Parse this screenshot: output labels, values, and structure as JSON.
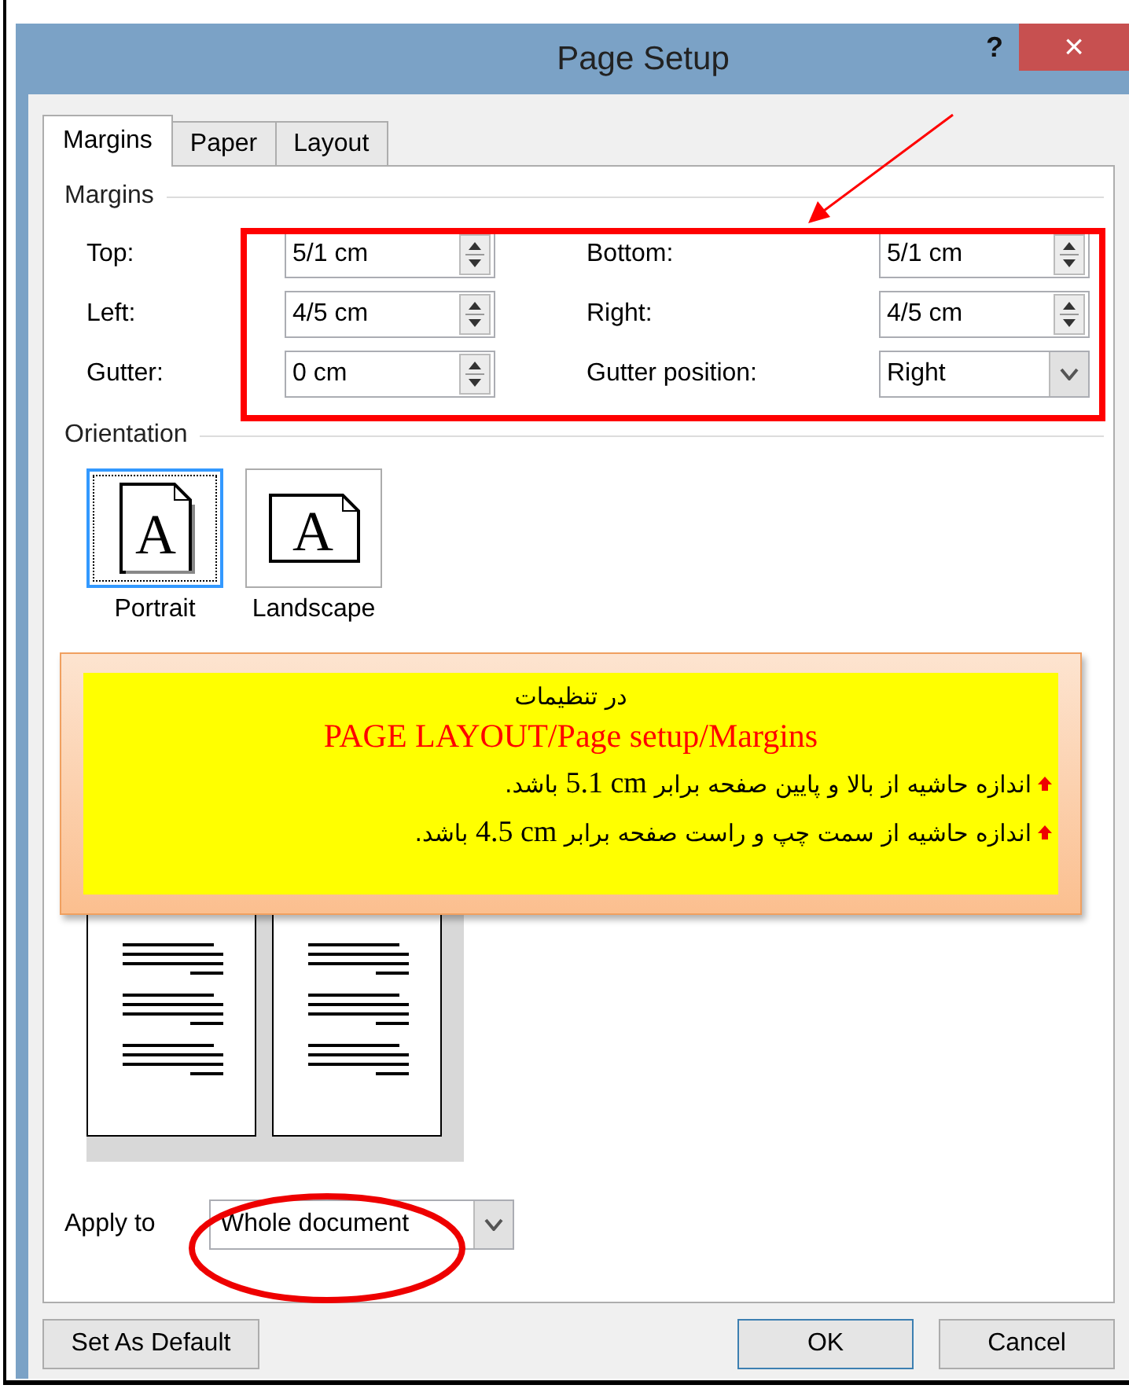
{
  "window": {
    "title": "Page Setup",
    "help_label": "?",
    "close_label": "×"
  },
  "tabs": [
    {
      "label": "Margins",
      "selected": true
    },
    {
      "label": "Paper",
      "selected": false
    },
    {
      "label": "Layout",
      "selected": false
    }
  ],
  "margins": {
    "heading": "Margins",
    "fields": [
      {
        "label": "Top:",
        "value": "5/1 cm",
        "kind": "spin"
      },
      {
        "label": "Bottom:",
        "value": "5/1 cm",
        "kind": "spin"
      },
      {
        "label": "Left:",
        "value": "4/5 cm",
        "kind": "spin"
      },
      {
        "label": "Right:",
        "value": "4/5 cm",
        "kind": "spin"
      },
      {
        "label": "Gutter:",
        "value": "0 cm",
        "kind": "spin"
      },
      {
        "label": "Gutter position:",
        "value": "Right",
        "kind": "dropdown"
      }
    ]
  },
  "orientation": {
    "heading": "Orientation",
    "options": [
      {
        "label": "Portrait",
        "selected": true,
        "kind": "portrait",
        "icon_letter": "A"
      },
      {
        "label": "Landscape",
        "selected": false,
        "kind": "landscape",
        "icon_letter": "A"
      }
    ]
  },
  "callout": {
    "title": "در تنظیمات",
    "path": "PAGE LAYOUT/Page setup/Margins",
    "bullets": [
      {
        "before": "اندازه حاشیه از بالا و پایین صفحه برابر",
        "value": "5.1 cm",
        "after": "باشد."
      },
      {
        "before": "اندازه حاشیه از سمت چپ و راست صفحه برابر",
        "value": "4.5 cm",
        "after": "باشد."
      }
    ]
  },
  "apply_to": {
    "label": "Apply to",
    "value": "Whole document"
  },
  "buttons": [
    {
      "label": "Set As Default",
      "default": false
    },
    {
      "label": "OK",
      "default": true
    },
    {
      "label": "Cancel",
      "default": false
    }
  ]
}
